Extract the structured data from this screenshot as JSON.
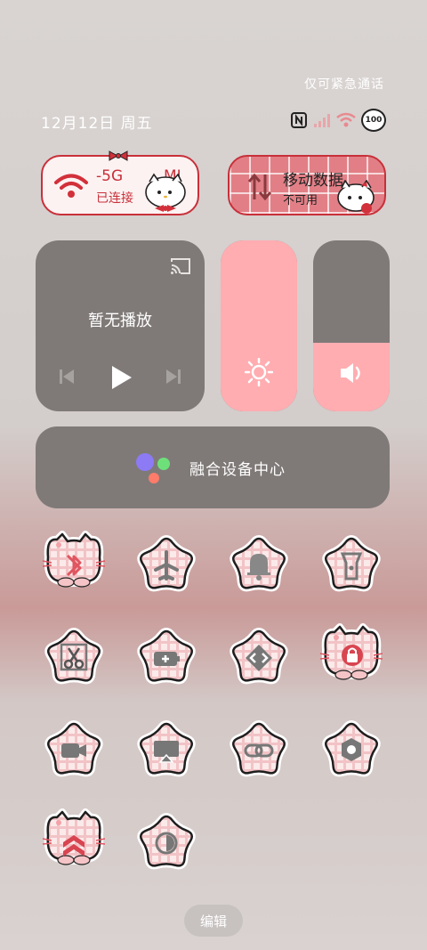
{
  "status_bar": {
    "emergency_text": "仅可紧急通话",
    "date": "12月12日 周五",
    "battery": "100",
    "icons": [
      "nfc-icon",
      "signal-icon",
      "wifi-icon",
      "battery-icon"
    ]
  },
  "wifi_pill": {
    "title": "-5G MI",
    "title_left": "-5G",
    "title_right": "MI",
    "subtitle": "已连接"
  },
  "data_pill": {
    "title": "移动数据",
    "subtitle": "不可用"
  },
  "media": {
    "label": "暂无播放"
  },
  "brightness": {
    "level": 1.0
  },
  "volume": {
    "level": 0.4
  },
  "hub": {
    "label": "融合设备中心"
  },
  "tiles": [
    {
      "name": "bluetooth",
      "icon": "bluetooth-icon",
      "shape": "cat"
    },
    {
      "name": "airplane-mode",
      "icon": "airplane-icon",
      "shape": "star"
    },
    {
      "name": "ring-mode",
      "icon": "bell-icon",
      "shape": "star"
    },
    {
      "name": "flashlight",
      "icon": "flashlight-icon",
      "shape": "star"
    },
    {
      "name": "screenshot",
      "icon": "scissors-icon",
      "shape": "star"
    },
    {
      "name": "battery-saver",
      "icon": "battery-plus-icon",
      "shape": "star"
    },
    {
      "name": "nearby-share",
      "icon": "share-diamond-icon",
      "shape": "star"
    },
    {
      "name": "rotation-lock",
      "icon": "rotation-lock-icon",
      "shape": "cat"
    },
    {
      "name": "screen-record",
      "icon": "video-camera-icon",
      "shape": "star"
    },
    {
      "name": "screen-cast",
      "icon": "cast-icon",
      "shape": "star"
    },
    {
      "name": "link",
      "icon": "link-icon",
      "shape": "star"
    },
    {
      "name": "settings",
      "icon": "gear-icon",
      "shape": "star"
    },
    {
      "name": "performance-mode",
      "icon": "chevrons-up-icon",
      "shape": "cat"
    },
    {
      "name": "dark-mode",
      "icon": "contrast-icon",
      "shape": "star"
    }
  ],
  "edit_button": {
    "label": "编辑"
  },
  "colors": {
    "accent": "#c8303a",
    "pink": "#ffadb1",
    "card": "#7f7a78"
  }
}
